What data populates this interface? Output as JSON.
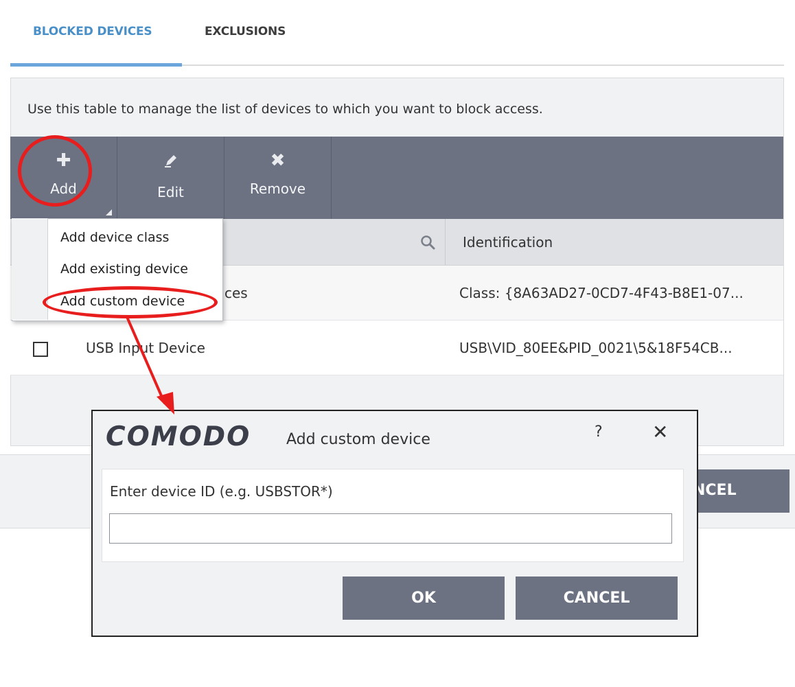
{
  "tabs": [
    {
      "label": "BLOCKED DEVICES",
      "active": true
    },
    {
      "label": "EXCLUSIONS",
      "active": false
    }
  ],
  "description": "Use this table to manage the list of devices to which you want to block access.",
  "toolbar": {
    "add": "Add",
    "edit": "Edit",
    "remove": "Remove"
  },
  "table": {
    "columns": [
      "",
      "Identification"
    ],
    "rows": [
      {
        "name": "ces",
        "identification": "Class: {8A63AD27-0CD7-4F43-B8E1-07..."
      },
      {
        "name": "USB Input Device",
        "identification": "USB\\VID_80EE&PID_0021\\5&18F54CB..."
      }
    ]
  },
  "add_menu": {
    "items": [
      "Add device class",
      "Add existing device",
      "Add custom device"
    ]
  },
  "background": {
    "cancel_partial": "NCEL"
  },
  "dialog": {
    "brand": "COMODO",
    "title": "Add custom device",
    "help": "?",
    "close": "✕",
    "field_label": "Enter device ID (e.g. USBSTOR*)",
    "field_value": "",
    "ok": "OK",
    "cancel": "CANCEL"
  },
  "colors": {
    "accent_tab": "#4a90c8",
    "toolbar": "#6c7282",
    "annotation": "#e81d1d"
  }
}
